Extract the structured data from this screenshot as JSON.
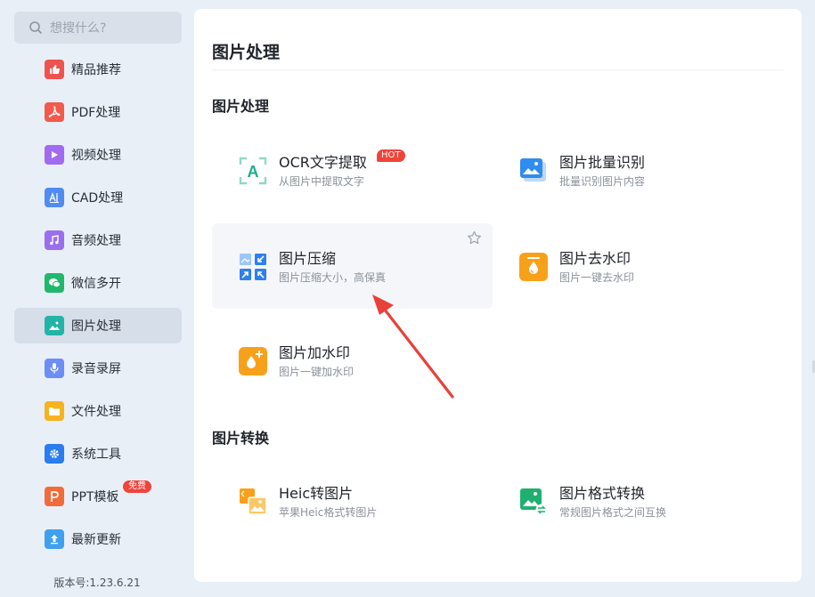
{
  "search": {
    "placeholder": "想搜什么?"
  },
  "sidebar": {
    "items": [
      {
        "label": "精品推荐",
        "icon": "thumbs-up-icon",
        "color": "#ef5350"
      },
      {
        "label": "PDF处理",
        "icon": "pdf-icon",
        "color": "#f25a4b"
      },
      {
        "label": "视频处理",
        "icon": "play-icon",
        "color": "#a26af0"
      },
      {
        "label": "CAD处理",
        "icon": "cad-icon",
        "color": "#4f8bf0"
      },
      {
        "label": "音频处理",
        "icon": "music-icon",
        "color": "#9b6ef0"
      },
      {
        "label": "微信多开",
        "icon": "wechat-icon",
        "color": "#1fb86c"
      },
      {
        "label": "图片处理",
        "icon": "image-icon",
        "color": "#22b4a7"
      },
      {
        "label": "录音录屏",
        "icon": "microphone-icon",
        "color": "#6c8ef5"
      },
      {
        "label": "文件处理",
        "icon": "folder-icon",
        "color": "#f6b21f"
      },
      {
        "label": "系统工具",
        "icon": "gear-icon",
        "color": "#2a7cf0"
      },
      {
        "label": "PPT模板",
        "icon": "ppt-icon",
        "color": "#f26b3a",
        "badge": "免费"
      },
      {
        "label": "最新更新",
        "icon": "upload-icon",
        "color": "#3fa0f0"
      }
    ],
    "active_index": 6,
    "version": "版本号:1.23.6.21"
  },
  "main": {
    "title": "图片处理",
    "sections": [
      {
        "title": "图片处理",
        "tools": [
          {
            "name": "OCR文字提取",
            "desc": "从图片中提取文字",
            "icon": "ocr-icon",
            "badge": "HOT"
          },
          {
            "name": "图片批量识别",
            "desc": "批量识别图片内容",
            "icon": "batch-image-icon"
          },
          {
            "name": "图片压缩",
            "desc": "图片压缩大小，高保真",
            "icon": "compress-icon"
          },
          {
            "name": "图片去水印",
            "desc": "图片一键去水印",
            "icon": "remove-watermark-icon"
          },
          {
            "name": "图片加水印",
            "desc": "图片一键加水印",
            "icon": "add-watermark-icon"
          }
        ]
      },
      {
        "title": "图片转换",
        "tools": [
          {
            "name": "Heic转图片",
            "desc": "苹果Heic格式转图片",
            "icon": "heic-convert-icon"
          },
          {
            "name": "图片格式转换",
            "desc": "常规图片格式之间互换",
            "icon": "format-convert-icon"
          }
        ]
      }
    ]
  },
  "colors": {
    "accent_red": "#f0443b",
    "hot_badge": "#f0443b",
    "arrow": "#e8413a"
  }
}
